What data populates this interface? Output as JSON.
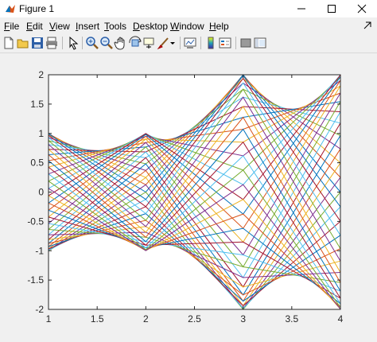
{
  "window": {
    "title": "Figure 1"
  },
  "menu": [
    {
      "label": "File",
      "accel": "F",
      "rest": "ile"
    },
    {
      "label": "Edit",
      "accel": "E",
      "rest": "dit"
    },
    {
      "label": "View",
      "accel": "V",
      "rest": "iew"
    },
    {
      "label": "Insert",
      "accel": "I",
      "rest": "nsert"
    },
    {
      "label": "Tools",
      "accel": "T",
      "rest": "ools"
    },
    {
      "label": "Desktop",
      "accel": "D",
      "rest": "esktop"
    },
    {
      "label": "Window",
      "accel": "W",
      "rest": "indow"
    },
    {
      "label": "Help",
      "accel": "H",
      "rest": "elp"
    }
  ],
  "toolbar": [
    "new-figure-icon",
    "open-file-icon",
    "save-icon",
    "print-icon",
    "pointer-icon",
    "zoom-in-icon",
    "zoom-out-icon",
    "pan-icon",
    "rotate-3d-icon",
    "data-cursor-icon",
    "brush-icon",
    "link-plot-icon",
    "colorbar-icon",
    "legend-icon",
    "hide-plot-tools-icon",
    "show-plot-tools-icon"
  ],
  "colors": {
    "line_order": [
      "#0072bd",
      "#d95319",
      "#edb120",
      "#7e2f8e",
      "#77ac30",
      "#4dbeee",
      "#a2142f"
    ]
  },
  "chart_data": {
    "type": "line",
    "title": "",
    "xlabel": "",
    "ylabel": "",
    "xlim": [
      1,
      4
    ],
    "ylim": [
      -2,
      2
    ],
    "x": [
      1,
      2,
      3,
      4
    ],
    "xticks": [
      1,
      1.5,
      2,
      2.5,
      3,
      3.5,
      4
    ],
    "xtick_labels": [
      "1",
      "1.5",
      "2",
      "2.5",
      "3",
      "3.5",
      "4"
    ],
    "yticks": [
      -2,
      -1.5,
      -1,
      -0.5,
      0,
      0.5,
      1,
      1.5,
      2
    ],
    "ytick_labels": [
      "-2",
      "-1.5",
      "-1",
      "-0.5",
      "0",
      "0.5",
      "1",
      "1.5",
      "2"
    ],
    "grid": false,
    "legend": "none",
    "series_count": 50,
    "series_pattern": "each line n = 0..49: y = [cos(t), sin(t), 2*cos(t), 2*sin(t)] with t = 2*pi*n/50",
    "example_series": [
      {
        "values": [
          1,
          0,
          2,
          0
        ]
      },
      {
        "values": [
          0,
          1,
          0,
          2
        ]
      },
      {
        "values": [
          -1,
          0,
          -2,
          0
        ]
      },
      {
        "values": [
          0,
          -1,
          0,
          -2
        ]
      }
    ]
  }
}
